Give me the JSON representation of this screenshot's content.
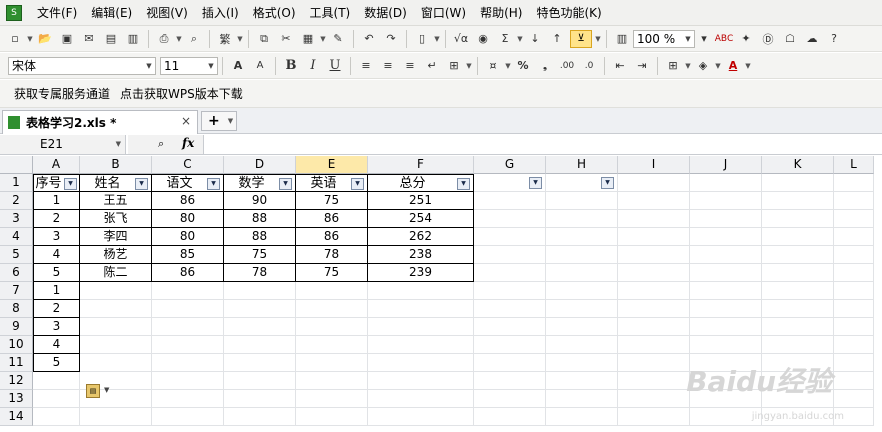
{
  "menubar": {
    "items": [
      "文件(F)",
      "编辑(E)",
      "视图(V)",
      "插入(I)",
      "格式(O)",
      "工具(T)",
      "数据(D)",
      "窗口(W)",
      "帮助(H)",
      "特色功能(K)"
    ]
  },
  "toolbar": {
    "zoom": "100 %",
    "font_name": "宋体",
    "font_size": "11",
    "bold": "B",
    "italic": "I",
    "underline": "U",
    "percent": "%",
    "sigma": "Σ",
    "fx_small": "√α",
    "grow_font": "A",
    "shrink_font": "A",
    "font_color": "A",
    "dec_inc": ".00",
    "dec_dec": ".0",
    "abc": "ABC"
  },
  "links": {
    "service": "获取专属服务通道",
    "download": "点击获取WPS版本下载"
  },
  "doc_tab": {
    "name": "表格学习2.xls *",
    "close": "×",
    "new": "+"
  },
  "formula": {
    "cell_ref": "E21",
    "fx": "fx"
  },
  "columns": [
    "A",
    "B",
    "C",
    "D",
    "E",
    "F",
    "G",
    "H",
    "I",
    "J",
    "K",
    "L"
  ],
  "rows": [
    "1",
    "2",
    "3",
    "4",
    "5",
    "6",
    "7",
    "8",
    "9",
    "10",
    "11",
    "12",
    "13",
    "14"
  ],
  "table": {
    "headers": [
      "序号",
      "姓名",
      "语文",
      "数学",
      "英语",
      "总分"
    ],
    "rows": [
      [
        "1",
        "王五",
        "86",
        "90",
        "75",
        "251"
      ],
      [
        "2",
        "张飞",
        "80",
        "88",
        "86",
        "254"
      ],
      [
        "3",
        "李四",
        "80",
        "88",
        "86",
        "262"
      ],
      [
        "4",
        "杨艺",
        "85",
        "75",
        "78",
        "238"
      ],
      [
        "5",
        "陈二",
        "86",
        "78",
        "75",
        "239"
      ]
    ],
    "extra_a": [
      "1",
      "2",
      "3",
      "4",
      "5"
    ]
  },
  "watermark": {
    "main": "Baidu经验",
    "sub": "jingyan.baidu.com"
  }
}
